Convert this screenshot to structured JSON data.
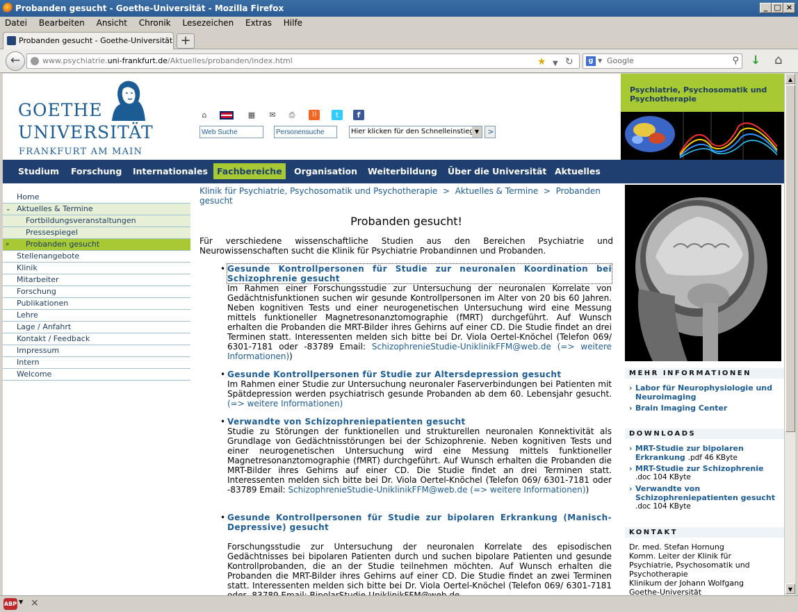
{
  "window": {
    "title": "Probanden gesucht - Goethe-Universität - Mozilla Firefox"
  },
  "menubar": [
    "Datei",
    "Bearbeiten",
    "Ansicht",
    "Chronik",
    "Lesezeichen",
    "Extras",
    "Hilfe"
  ],
  "tab": {
    "title": "Probanden gesucht - Goethe-Universität",
    "new_tab": "+"
  },
  "urlbar": {
    "prefix": "www.psychiatrie.",
    "domain": "uni-frankfurt.de",
    "path": "/Aktuelles/probanden/index.html"
  },
  "search": {
    "placeholder": "Google",
    "engine_letter": "g"
  },
  "statusbar": {
    "abp": "ABP",
    "close": "×"
  },
  "logo": {
    "line1": "GOETHE",
    "line2": "UNIVERSITÄT",
    "line3": "FRANKFURT AM MAIN"
  },
  "header_icons": [
    "home-icon",
    "uk-flag-icon",
    "sitemap-icon",
    "mail-icon",
    "print-icon",
    "rss-icon",
    "twitter-icon",
    "facebook-icon"
  ],
  "search_fields": {
    "web": "Web Suche",
    "persons": "Personensuche",
    "quick": "Hier klicken für den Schnelleinstieg",
    "go": ">"
  },
  "banner": {
    "title": "Psychiatrie, Psychosomatik und Psychotherapie"
  },
  "mainnav": [
    "Studium",
    "Forschung",
    "Internationales",
    "Fachbereiche",
    "Organisation",
    "Weiterbildung",
    "Über die Universität",
    "Aktuelles"
  ],
  "mainnav_active": "Fachbereiche",
  "leftnav": [
    {
      "label": "Home"
    },
    {
      "label": "Aktuelles & Termine"
    },
    {
      "label": "Fortbildungsveranstaltungen"
    },
    {
      "label": "Pressespiegel"
    },
    {
      "label": "Probanden gesucht"
    },
    {
      "label": "Stellenangebote"
    },
    {
      "label": "Klinik"
    },
    {
      "label": "Mitarbeiter"
    },
    {
      "label": "Forschung"
    },
    {
      "label": "Publikationen"
    },
    {
      "label": "Lehre"
    },
    {
      "label": "Lage / Anfahrt"
    },
    {
      "label": "Kontakt / Feedback"
    },
    {
      "label": "Impressum"
    },
    {
      "label": "Intern"
    },
    {
      "label": "Welcome"
    }
  ],
  "breadcrumb": {
    "b1": "Klinik für Psychiatrie, Psychosomatik und Psychotherapie",
    "sep": ">",
    "b2": "Aktuelles & Termine",
    "b3": "Probanden gesucht"
  },
  "page_title": "Probanden gesucht!",
  "intro": "Für verschiedene wissenschaftliche Studien aus den Bereichen Psychiatrie und Neurowissenschaften sucht die Klinik für Psychiatrie Probandinnen und Probanden.",
  "items": [
    {
      "heading": "Gesunde Kontrollpersonen für Studie zur neuronalen Koordination bei Schizophrenie gesucht",
      "text": "Im Rahmen einer Forschungsstudie zur Untersuchung der neuronalen Korrelate von Gedächtnisfunktionen suchen wir gesunde Kontrollpersonen im Alter von 20 bis 60 Jahren. Neben kognitiven Tests und einer neurogenetischen Untersuchung wird eine Messung mittels funktioneller Magnetresonanztomographie (fMRT) durchgeführt. Auf Wunsch erhalten die Probanden die MRT-Bilder ihres Gehirns auf einer CD. Die Studie findet an drei Terminen statt. Interessenten melden sich bitte bei Dr. Viola Oertel-Knöchel (Telefon 069/ 6301-7181 oder -83789 Email: ",
      "email": "SchizophrenieStudie-UniklinikFFM@web.de",
      "more": "(=> weitere Informationen)",
      "tail": ")"
    },
    {
      "heading": "Gesunde Kontrollpersonen für Studie zur Altersdepression gesucht",
      "text": "Im Rahmen einer Studie zur Untersuchung neuronaler Faserverbindungen bei Patienten mit Spätdepression werden psychiatrisch gesunde Probanden ab dem 60. Lebensjahr gesucht. ",
      "more": "(=> weitere Informationen)"
    },
    {
      "heading": "Verwandte von Schizophreniepatienten gesucht",
      "text": "Studie zu Störungen der funktionellen und strukturellen neuronalen Konnektivität als Grundlage von Gedächtnisstörungen bei der Schizophrenie. Neben kognitiven Tests und einer neurogenetischen Untersuchung wird eine Messung mittels funktioneller Magnetresonanztomographie (fMRT) durchgeführt. Auf Wunsch erhalten die Probanden die MRT-Bilder ihres Gehirns auf einer CD. Die Studie findet an drei Terminen statt. Interessenten melden sich bitte bei Dr. Viola Oertel-Knöchel (Telefon 069/ 6301-7181 oder -83789 Email: ",
      "email": "SchizophrenieStudie-UniklinikFFM@web.de",
      "more": "(=> weitere Informationen)",
      "tail": ")"
    },
    {
      "heading": "Gesunde Kontrollpersonen für Studie zur bipolaren Erkrankung (Manisch-Depressive) gesucht",
      "text": "Forschungsstudie zur Untersuchung der neuronalen Korrelate des episodischen Gedächtnisses bei bipolaren Patienten durch und suchen bipolare Patienten und gesunde Kontrollprobanden, die an der Studie teilnehmen möchten. Auf Wunsch erhalten die Probanden die MRT-Bilder ihres Gehirns auf einer CD. Die Studie findet an zwei Terminen statt. Interessenten melden sich bitte bei Dr. Viola Oertel-Knöchel (Telefon 069/ 6301-7181 oder -83789 Email: BipolarStudie-UniklinikFFM@web.de"
    }
  ],
  "right": {
    "more_header": "MEHR INFORMATIONEN",
    "more_links": [
      "Labor für Neurophysiologie und Neuroimaging",
      "Brain Imaging Center"
    ],
    "downloads_header": "DOWNLOADS",
    "downloads": [
      {
        "label": "MRT-Studie zur bipolaren Erkrankung",
        "note": ".pdf 46 KByte"
      },
      {
        "label": "MRT-Studie zur Schizophrenie",
        "note": ".doc 104 KByte"
      },
      {
        "label": "Verwandte von Schizophreniepatienten gesucht",
        "note": ".doc 104 KByte"
      }
    ],
    "kontakt_header": "KONTAKT",
    "kontakt_lines": [
      "Dr. med. Stefan Hornung",
      "Komm. Leiter der Klinik für",
      "Psychiatrie, Psychosomatik und",
      "Psychotherapie",
      "Klinikum der Johann Wolfgang",
      "Goethe-Universität"
    ]
  },
  "colors": {
    "accent_green": "#a6c934",
    "nav_blue": "#1f3f70",
    "link_blue": "#1c5c95"
  }
}
